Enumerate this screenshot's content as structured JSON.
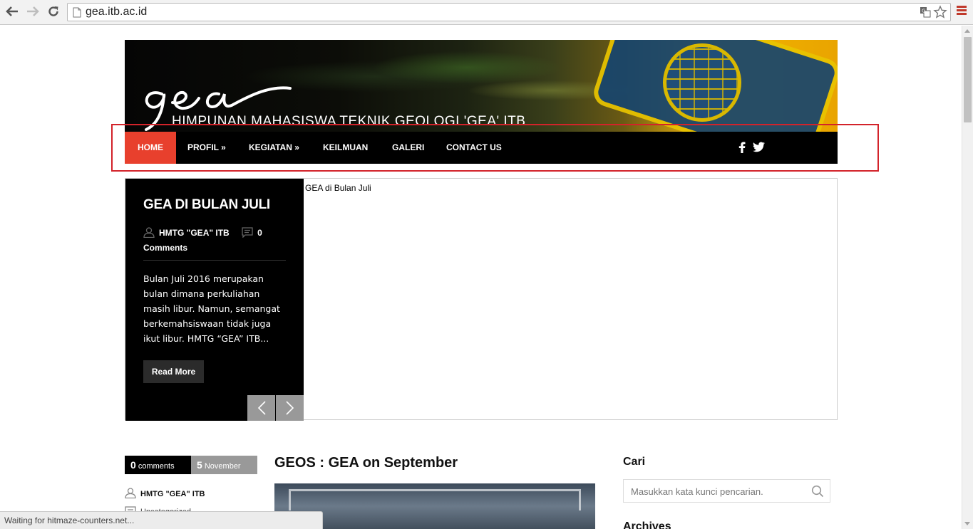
{
  "browser": {
    "url": "gea.itb.ac.id",
    "status_text": "Waiting for hitmaze-counters.net..."
  },
  "header": {
    "logo_text": "gea",
    "subtitle": "HIMPUNAN MAHASISWA TEKNIK GEOLOGI 'GEA' ITB"
  },
  "nav": {
    "items": [
      {
        "label": "HOME",
        "active": true
      },
      {
        "label": "PROFIL »"
      },
      {
        "label": "KEGIATAN »"
      },
      {
        "label": "KEILMUAN"
      },
      {
        "label": "GALERI"
      },
      {
        "label": "CONTACT US"
      }
    ],
    "social": [
      "facebook-icon",
      "twitter-icon"
    ],
    "active_color": "#e8402d"
  },
  "slider": {
    "title": "GEA DI BULAN JULI",
    "author": "HMTG \"GEA\" ITB",
    "comments_count": "0",
    "comments_label": "Comments",
    "excerpt": "Bulan Juli 2016 merupakan bulan dimana perkuliahan masih libur. Namun, semangat berkemahsiswaan tidak juga ikut libur. HMTG “GEA” ITB...",
    "read_more": "Read More",
    "image_alt": "GEA di Bulan Juli"
  },
  "post": {
    "comments_count": "0",
    "comments_label": "comments",
    "day": "5",
    "month": "November",
    "author": "HMTG \"GEA\" ITB",
    "category": "Uncategorized",
    "title": "GEOS : GEA on September"
  },
  "sidebar": {
    "search_title": "Cari",
    "search_placeholder": "Masukkan kata kunci pencarian.",
    "archives_title": "Archives"
  }
}
